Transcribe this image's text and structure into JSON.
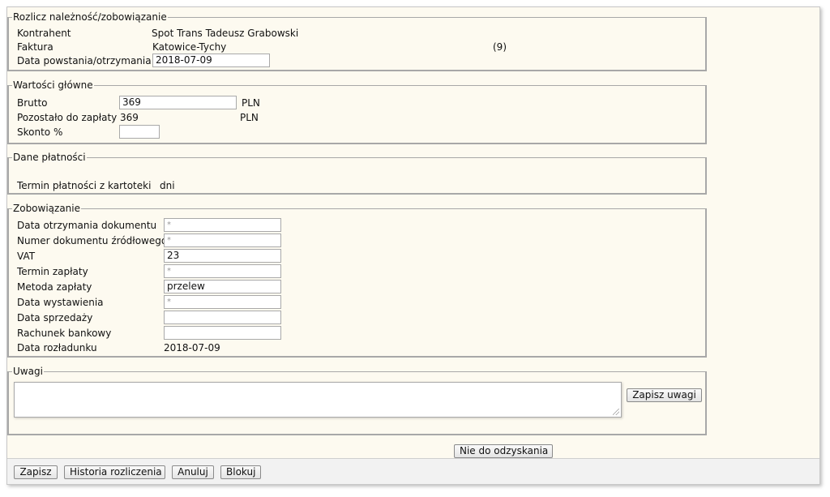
{
  "settle": {
    "legend": "Rozlicz należność/zobowiązanie",
    "contractor_label": "Kontrahent",
    "contractor_value": "Spot Trans Tadeusz Grabowski",
    "invoice_label": "Faktura",
    "invoice_value": "Katowice-Tychy",
    "invoice_count": "(9)",
    "date_label": "Data powstania/otrzymania",
    "date_value": "2018-07-09"
  },
  "main_values": {
    "legend": "Wartości główne",
    "gross_label": "Brutto",
    "gross_value": "369",
    "gross_currency": "PLN",
    "remaining_label": "Pozostało do zapłaty",
    "remaining_value": "369",
    "remaining_currency": "PLN",
    "discount_label": "Skonto %",
    "discount_value": ""
  },
  "payment": {
    "legend": "Dane płatności",
    "term_label": "Termin płatności z kartoteki",
    "term_unit": "dni"
  },
  "liability": {
    "legend": "Zobowiązanie",
    "receipt_date_label": "Data otrzymania dokumentu",
    "receipt_date_value": "*",
    "source_doc_label": "Numer dokumentu źródłowego",
    "source_doc_value": "*",
    "vat_label": "VAT",
    "vat_value": "23",
    "payment_due_label": "Termin zapłaty",
    "payment_due_value": "*",
    "payment_method_label": "Metoda zapłaty",
    "payment_method_value": "przelew",
    "issue_date_label": "Data wystawienia",
    "issue_date_value": "*",
    "sale_date_label": "Data sprzedaży",
    "sale_date_value": "",
    "bank_account_label": "Rachunek bankowy",
    "bank_account_value": "",
    "unload_date_label": "Data rozładunku",
    "unload_date_value": "2018-07-09"
  },
  "notes": {
    "legend": "Uwagi",
    "text": "",
    "save_notes_label": "Zapisz uwagi"
  },
  "uncollectible_label": "Nie do odzyskania",
  "toolbar": {
    "save_label": "Zapisz",
    "history_label": "Historia rozliczenia",
    "cancel_label": "Anuluj",
    "block_label": "Blokuj"
  }
}
